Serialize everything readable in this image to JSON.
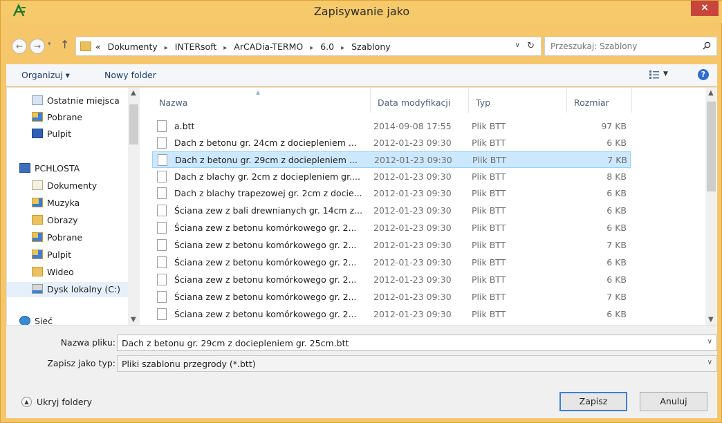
{
  "window": {
    "title": "Zapisywanie jako",
    "close_label": "×"
  },
  "address": {
    "prefix": "«",
    "crumbs": [
      "Dokumenty",
      "INTERsoft",
      "ArCADia-TERMO",
      "6.0",
      "Szablony"
    ],
    "separator": "▸"
  },
  "search": {
    "placeholder": "Przeszukaj: Szablony"
  },
  "toolbar": {
    "organize_label": "Organizuj ▾",
    "new_folder_label": "Nowy folder",
    "help_label": "?"
  },
  "nav": {
    "items": [
      {
        "label": "Ostatnie miejsca",
        "icon": "recent-places-icon"
      },
      {
        "label": "Pobrane",
        "icon": "downloads-folder-icon"
      },
      {
        "label": "Pulpit",
        "icon": "desktop-icon"
      },
      {
        "label": "PCHLOSTA",
        "icon": "computer-icon"
      },
      {
        "label": "Dokumenty",
        "icon": "documents-icon"
      },
      {
        "label": "Muzyka",
        "icon": "music-folder-icon"
      },
      {
        "label": "Obrazy",
        "icon": "pictures-folder-icon"
      },
      {
        "label": "Pobrane",
        "icon": "downloads-folder-icon"
      },
      {
        "label": "Pulpit",
        "icon": "desktop-folder-icon"
      },
      {
        "label": "Wideo",
        "icon": "video-folder-icon"
      },
      {
        "label": "Dysk lokalny (C:)",
        "icon": "local-disk-icon"
      },
      {
        "label": "Sieć",
        "icon": "network-icon"
      }
    ]
  },
  "files": {
    "columns": {
      "name": "Nazwa",
      "date": "Data modyfikacji",
      "type": "Typ",
      "size": "Rozmiar"
    },
    "rows": [
      {
        "name": "a.btt",
        "date": "2014-09-08 17:55",
        "type": "Plik BTT",
        "size": "97 KB"
      },
      {
        "name": "Dach z betonu gr. 24cm z dociepleniem ...",
        "date": "2012-01-23 09:30",
        "type": "Plik BTT",
        "size": "6 KB"
      },
      {
        "name": "Dach z betonu gr. 29cm z dociepleniem ...",
        "date": "2012-01-23 09:30",
        "type": "Plik BTT",
        "size": "7 KB"
      },
      {
        "name": "Dach z blachy gr. 2cm z dociepleniem gr....",
        "date": "2012-01-23 09:30",
        "type": "Plik BTT",
        "size": "8 KB"
      },
      {
        "name": "Dach z blachy trapezowej gr. 2cm z docie...",
        "date": "2012-01-23 09:30",
        "type": "Plik BTT",
        "size": "6 KB"
      },
      {
        "name": "Ściana zew z bali drewnianych gr. 14cm z...",
        "date": "2012-01-23 09:30",
        "type": "Plik BTT",
        "size": "6 KB"
      },
      {
        "name": "Ściana zew z betonu komórkowego gr. 2...",
        "date": "2012-01-23 09:30",
        "type": "Plik BTT",
        "size": "6 KB"
      },
      {
        "name": "Ściana zew z betonu komórkowego gr. 2...",
        "date": "2012-01-23 09:30",
        "type": "Plik BTT",
        "size": "7 KB"
      },
      {
        "name": "Ściana zew z betonu komórkowego gr. 2...",
        "date": "2012-01-23 09:30",
        "type": "Plik BTT",
        "size": "6 KB"
      },
      {
        "name": "Ściana zew z betonu komórkowego gr. 2...",
        "date": "2012-01-23 09:30",
        "type": "Plik BTT",
        "size": "6 KB"
      },
      {
        "name": "Ściana zew z betonu komórkowego gr. 2...",
        "date": "2012-01-23 09:30",
        "type": "Plik BTT",
        "size": "7 KB"
      },
      {
        "name": "Ściana zew z betonu komórkowego gr. 2...",
        "date": "2012-01-23 09:30",
        "type": "Plik BTT",
        "size": "6 KB"
      }
    ]
  },
  "form": {
    "filename_label": "Nazwa pliku:",
    "filename_value": "Dach z betonu gr. 29cm z dociepleniem gr. 25cm.btt",
    "filetype_label": "Zapisz jako typ:",
    "filetype_value": "Pliki szablonu przegrody (*.btt)",
    "hide_folders_label": "Ukryj foldery",
    "save_label": "Zapisz",
    "cancel_label": "Anuluj"
  },
  "colors": {
    "titlebar": "#f6c96b",
    "close_button": "#c7453a",
    "selection": "#cce8ff",
    "link_text": "#1d3d6e"
  }
}
